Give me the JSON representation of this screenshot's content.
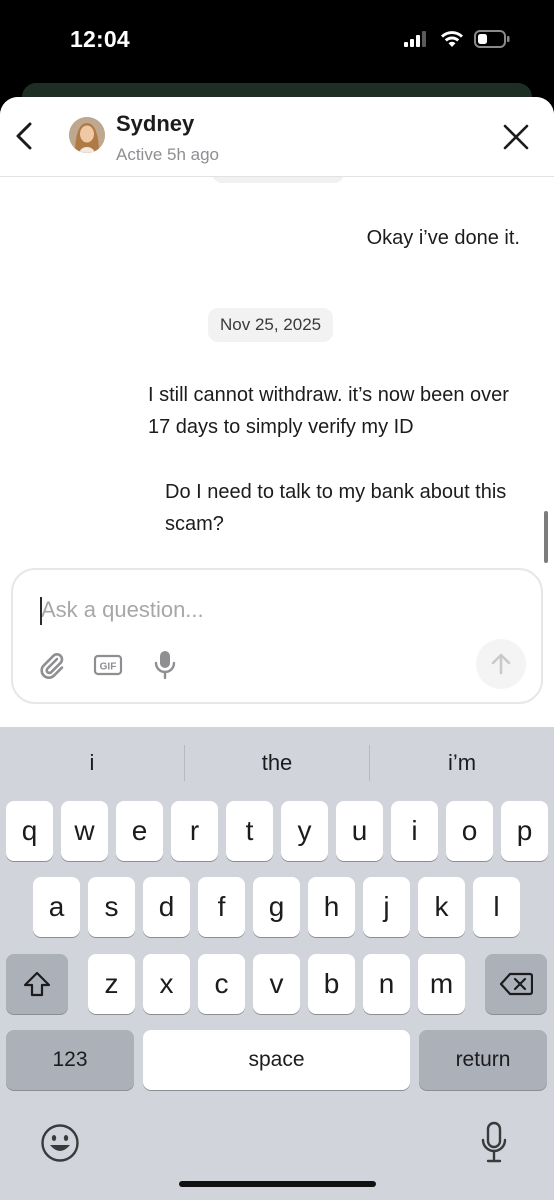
{
  "status_bar": {
    "time": "12:04",
    "icons": [
      "cellular-signal-icon",
      "wifi-icon",
      "battery-icon"
    ]
  },
  "header": {
    "contact_name": "Sydney",
    "contact_status": "Active 5h ago",
    "icons": [
      "chevron-left-icon",
      "close-icon"
    ]
  },
  "messages": [
    {
      "text": "Okay i’ve done it."
    },
    {
      "date_separator": "Nov 25, 2025"
    },
    {
      "text": "I still cannot withdraw. it’s now been over 17 days to simply verify my ID"
    },
    {
      "text": "Do I need to talk to my bank about this scam?"
    }
  ],
  "composer": {
    "placeholder": "Ask a question...",
    "value": "",
    "tools": [
      "paperclip-icon",
      "gif-icon",
      "microphone-icon"
    ],
    "send_icon": "arrow-up-icon"
  },
  "keyboard": {
    "suggestions": [
      "i",
      "the",
      "i’m"
    ],
    "rows": [
      [
        "q",
        "w",
        "e",
        "r",
        "t",
        "y",
        "u",
        "i",
        "o",
        "p"
      ],
      [
        "a",
        "s",
        "d",
        "f",
        "g",
        "h",
        "j",
        "k",
        "l"
      ],
      [
        "z",
        "x",
        "c",
        "v",
        "b",
        "n",
        "m"
      ]
    ],
    "numbers_key": "123",
    "space_key": "space",
    "return_key": "return",
    "icons": [
      "shift-icon",
      "backspace-icon",
      "emoji-icon",
      "dictation-icon"
    ]
  },
  "colors": {
    "keyboard_bg": "#d1d4da",
    "special_key_bg": "#abb0b9",
    "secondary_text": "#8e8e93"
  }
}
